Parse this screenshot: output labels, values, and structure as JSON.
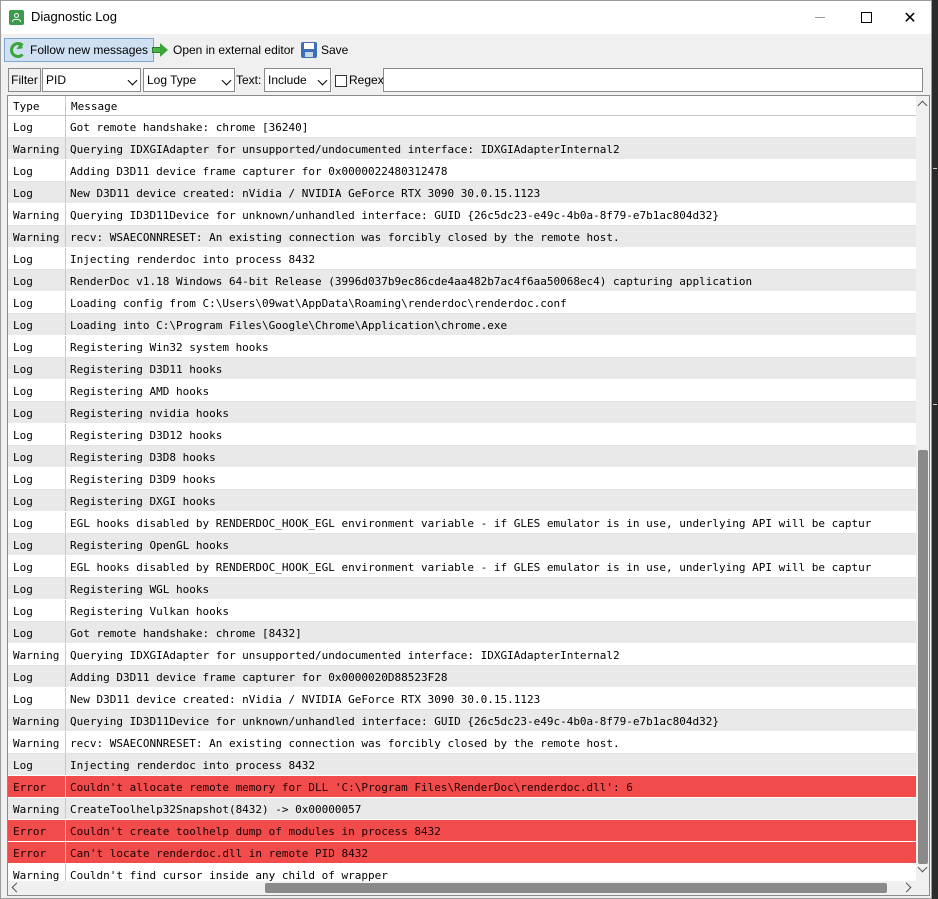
{
  "window": {
    "title": "Diagnostic Log",
    "controls": [
      "minimize-icon",
      "maximize-icon",
      "close-icon"
    ],
    "close_glyph": "✕"
  },
  "toolbar": {
    "follow_label": "Follow new messages",
    "follow_checked": true,
    "open_label": "Open in external editor",
    "save_label": "Save"
  },
  "filter": {
    "label": "Filter",
    "pid_value": "PID",
    "type_value": "Log Type",
    "text_label": "Text:",
    "text_mode_value": "Include",
    "regex_label": "Regex",
    "regex_checked": false,
    "search_value": ""
  },
  "table": {
    "columns": [
      "Type",
      "Message"
    ],
    "rows": [
      {
        "type": "Log",
        "message": "Got remote handshake: chrome [36240]"
      },
      {
        "type": "Warning",
        "message": "Querying IDXGIAdapter for unsupported/undocumented interface: IDXGIAdapterInternal2"
      },
      {
        "type": "Log",
        "message": "Adding D3D11 device frame capturer for 0x0000022480312478"
      },
      {
        "type": "Log",
        "message": "New D3D11 device created: nVidia / NVIDIA GeForce RTX 3090 30.0.15.1123"
      },
      {
        "type": "Warning",
        "message": "Querying ID3D11Device for unknown/unhandled interface: GUID {26c5dc23-e49c-4b0a-8f79-e7b1ac804d32}"
      },
      {
        "type": "Warning",
        "message": "recv: WSAECONNRESET: An existing connection was forcibly closed by the remote host."
      },
      {
        "type": "Log",
        "message": "Injecting renderdoc into process 8432"
      },
      {
        "type": "Log",
        "message": "RenderDoc v1.18 Windows 64-bit Release (3996d037b9ec86cde4aa482b7ac4f6aa50068ec4) capturing application"
      },
      {
        "type": "Log",
        "message": "Loading config from C:\\Users\\09wat\\AppData\\Roaming\\renderdoc\\renderdoc.conf"
      },
      {
        "type": "Log",
        "message": "Loading into C:\\Program Files\\Google\\Chrome\\Application\\chrome.exe"
      },
      {
        "type": "Log",
        "message": "Registering Win32 system hooks"
      },
      {
        "type": "Log",
        "message": "Registering D3D11 hooks"
      },
      {
        "type": "Log",
        "message": "Registering AMD hooks"
      },
      {
        "type": "Log",
        "message": "Registering nvidia hooks"
      },
      {
        "type": "Log",
        "message": "Registering D3D12 hooks"
      },
      {
        "type": "Log",
        "message": "Registering D3D8 hooks"
      },
      {
        "type": "Log",
        "message": "Registering D3D9 hooks"
      },
      {
        "type": "Log",
        "message": "Registering DXGI hooks"
      },
      {
        "type": "Log",
        "message": "EGL hooks disabled by RENDERDOC_HOOK_EGL environment variable - if GLES emulator is in use, underlying API will be captur"
      },
      {
        "type": "Log",
        "message": "Registering OpenGL hooks"
      },
      {
        "type": "Log",
        "message": "EGL hooks disabled by RENDERDOC_HOOK_EGL environment variable - if GLES emulator is in use, underlying API will be captur"
      },
      {
        "type": "Log",
        "message": "Registering WGL hooks"
      },
      {
        "type": "Log",
        "message": "Registering Vulkan hooks"
      },
      {
        "type": "Log",
        "message": "Got remote handshake: chrome [8432]"
      },
      {
        "type": "Warning",
        "message": "Querying IDXGIAdapter for unsupported/undocumented interface: IDXGIAdapterInternal2"
      },
      {
        "type": "Log",
        "message": "Adding D3D11 device frame capturer for 0x0000020D88523F28"
      },
      {
        "type": "Log",
        "message": "New D3D11 device created: nVidia / NVIDIA GeForce RTX 3090 30.0.15.1123"
      },
      {
        "type": "Warning",
        "message": "Querying ID3D11Device for unknown/unhandled interface: GUID {26c5dc23-e49c-4b0a-8f79-e7b1ac804d32}"
      },
      {
        "type": "Warning",
        "message": "recv: WSAECONNRESET: An existing connection was forcibly closed by the remote host."
      },
      {
        "type": "Log",
        "message": "Injecting renderdoc into process 8432"
      },
      {
        "type": "Error",
        "message": "Couldn't allocate remote memory for DLL 'C:\\Program Files\\RenderDoc\\renderdoc.dll': 6"
      },
      {
        "type": "Warning",
        "message": "CreateToolhelp32Snapshot(8432) -> 0x00000057"
      },
      {
        "type": "Error",
        "message": "Couldn't create toolhelp dump of modules in process 8432"
      },
      {
        "type": "Error",
        "message": "Can't locate renderdoc.dll in remote PID 8432"
      },
      {
        "type": "Warning",
        "message": "Couldn't find cursor inside any child of wrapper"
      }
    ]
  },
  "colors": {
    "error_row": "#f24b4b",
    "alt_row": "#e9e9e9",
    "accent_icon": "#3c9a4b"
  }
}
